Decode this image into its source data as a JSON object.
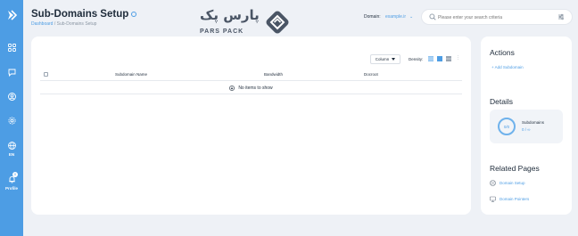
{
  "sidebar": {
    "items": [
      {
        "icon": "grid-icon"
      },
      {
        "icon": "chat-icon"
      },
      {
        "icon": "user-icon"
      },
      {
        "icon": "gear-icon"
      },
      {
        "icon": "globe-icon",
        "label": "EN"
      },
      {
        "icon": "bell-icon",
        "label": "Profile",
        "badge": "0"
      }
    ]
  },
  "header": {
    "title": "Sub-Domains Setup",
    "breadcrumb": {
      "home": "Dashboard",
      "separator": " / ",
      "current": "Sub-Domains Setup"
    },
    "brand": {
      "fa": "پارس پک",
      "en": "PARS PACK"
    },
    "domain_label": "Domain:",
    "domain_value": "example.ir",
    "search_placeholder": "Please enter your search criteria"
  },
  "table": {
    "columns_button": "Column",
    "density_label": "Density:",
    "headers": [
      "Subdomain Name",
      "Bandwidth",
      "Docroot"
    ],
    "empty_message": "No items to show"
  },
  "actions": {
    "heading": "Actions",
    "add_link": "+ Add Subdomain"
  },
  "details": {
    "heading": "Details",
    "ring_value": "0/0",
    "label": "Subdomains",
    "count": "0 / ∞"
  },
  "related": {
    "heading": "Related Pages",
    "items": [
      {
        "label": "Domain Setup",
        "icon": "domain-icon"
      },
      {
        "label": "Domain Pointers",
        "icon": "monitor-icon"
      }
    ]
  },
  "colors": {
    "accent": "#4d9de4",
    "background": "#eef1f6"
  }
}
